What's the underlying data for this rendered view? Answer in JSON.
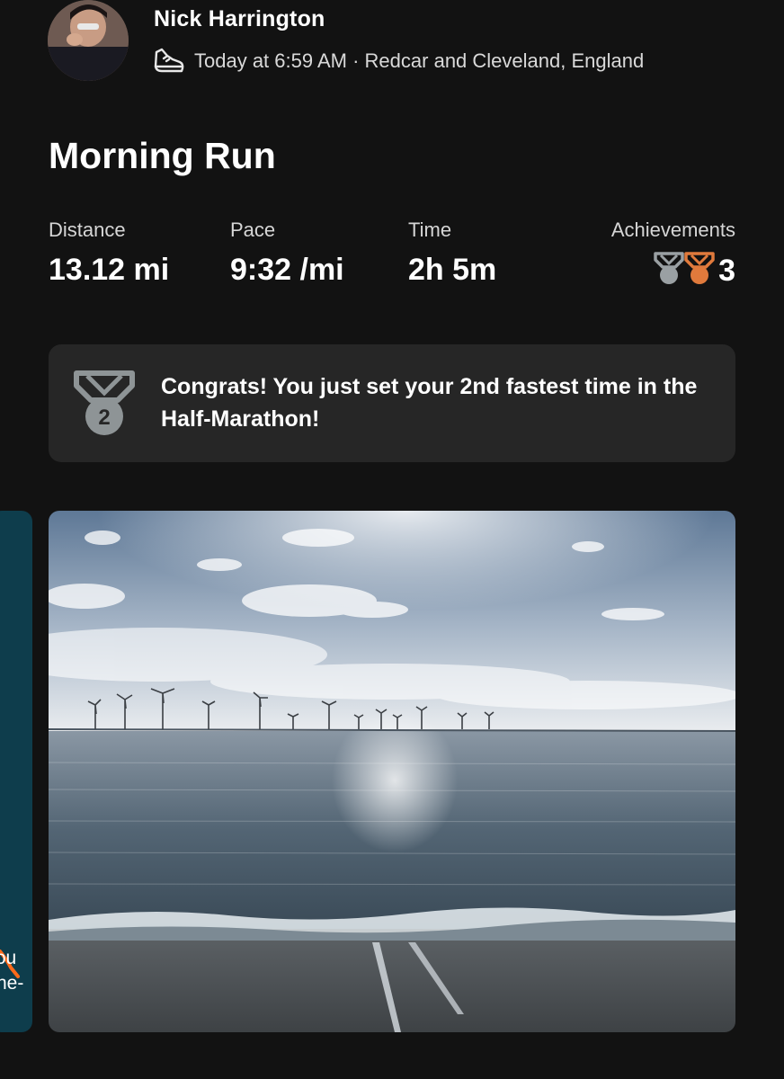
{
  "author": {
    "name": "Nick Harrington"
  },
  "meta": {
    "activity_icon": "running-shoe-icon",
    "timestamp_location": "Today at 6:59 AM · Redcar and Cleveland, England"
  },
  "activity": {
    "title": "Morning Run"
  },
  "stats": {
    "distance": {
      "label": "Distance",
      "value": "13.12 mi"
    },
    "pace": {
      "label": "Pace",
      "value": "9:32 /mi"
    },
    "time": {
      "label": "Time",
      "value": "2h 5m"
    },
    "achievements": {
      "label": "Achievements",
      "count": "3",
      "icons": [
        "silver-medal-icon",
        "bronze-medal-icon"
      ]
    }
  },
  "banner": {
    "medal_rank": "2",
    "text": "Congrats! You just set your 2nd fastest time in the Half-Marathon!"
  },
  "map_peek": {
    "label_line1": "ɔu",
    "label_line2": "ne-"
  },
  "colors": {
    "background": "#121212",
    "card": "#262626",
    "silver": "#9aa0a3",
    "bronze": "#e07a3c",
    "map": "#0e3d4c"
  }
}
